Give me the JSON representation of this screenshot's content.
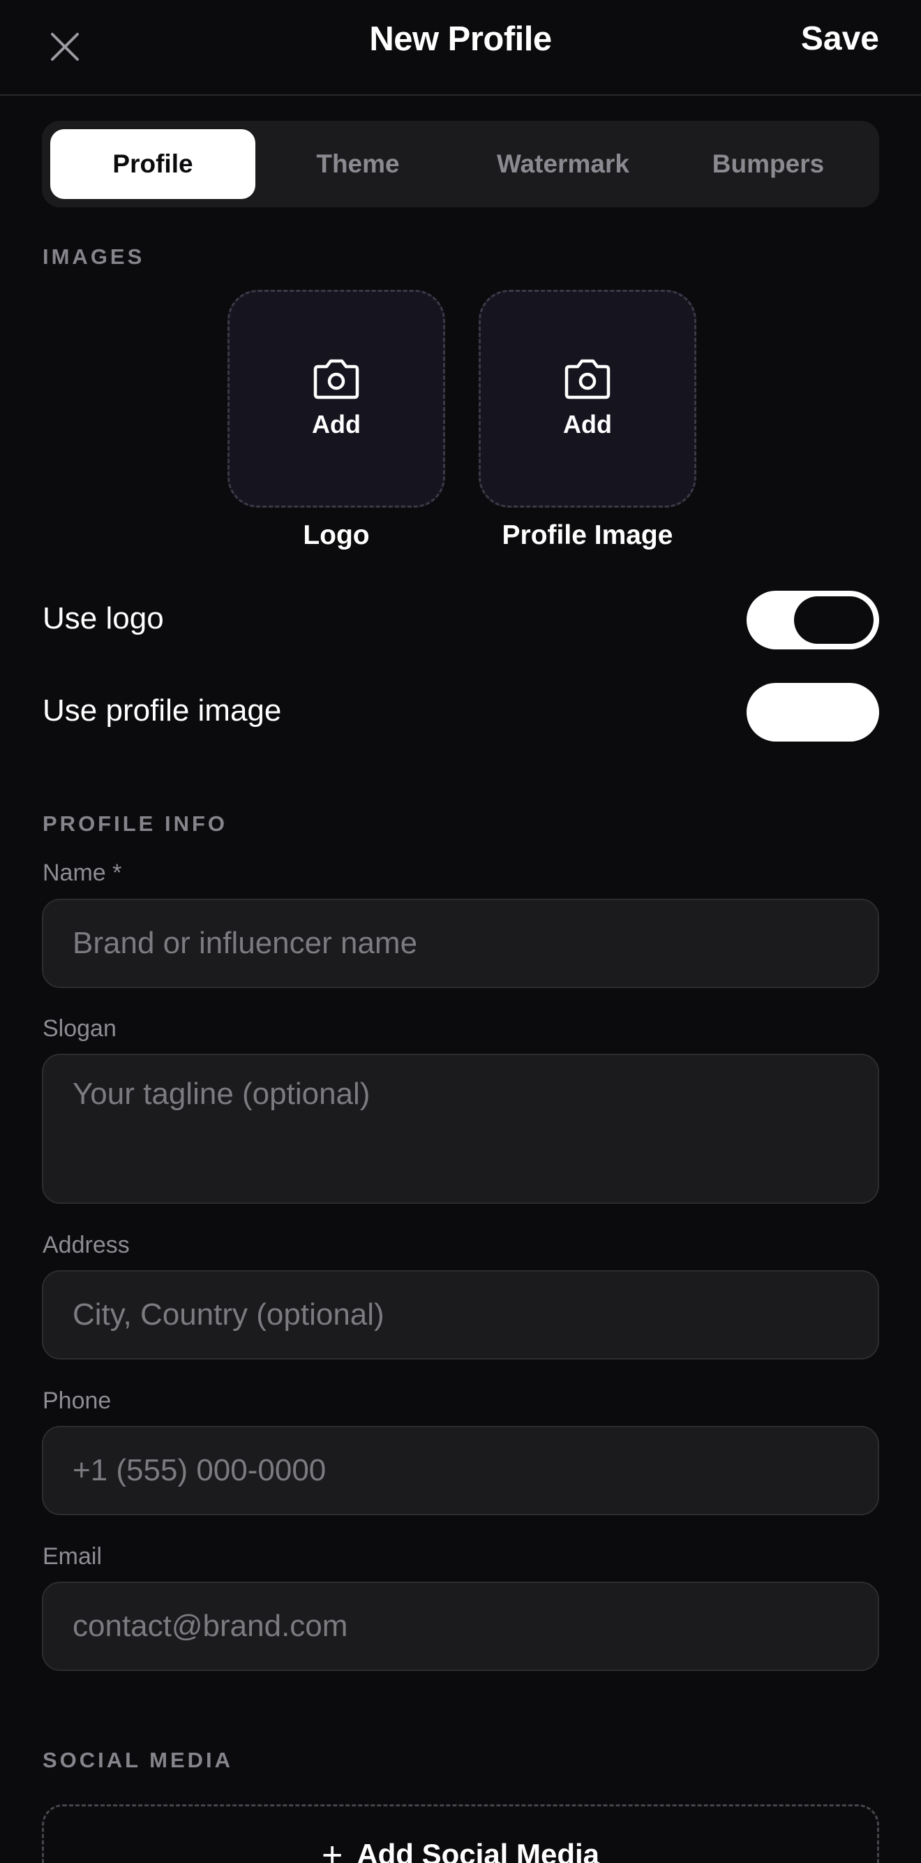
{
  "header": {
    "title": "New Profile",
    "save_label": "Save",
    "close_icon": "close-icon"
  },
  "tabs": [
    {
      "label": "Profile",
      "active": true
    },
    {
      "label": "Theme",
      "active": false
    },
    {
      "label": "Watermark",
      "active": false
    },
    {
      "label": "Bumpers",
      "active": false
    }
  ],
  "images": {
    "section_label": "IMAGES",
    "logo": {
      "action": "Add",
      "caption": "Logo",
      "icon": "camera-icon"
    },
    "profile_image": {
      "action": "Add",
      "caption": "Profile Image",
      "icon": "camera-icon"
    }
  },
  "toggles": {
    "use_logo": {
      "label": "Use logo",
      "on": true
    },
    "use_profile_image": {
      "label": "Use profile image",
      "on": false
    }
  },
  "profile_info": {
    "section_label": "PROFILE INFO",
    "name": {
      "label": "Name *",
      "placeholder": "Brand or influencer name",
      "value": ""
    },
    "slogan": {
      "label": "Slogan",
      "placeholder": "Your tagline (optional)",
      "value": ""
    },
    "address": {
      "label": "Address",
      "placeholder": "City, Country (optional)",
      "value": ""
    },
    "phone": {
      "label": "Phone",
      "placeholder": "+1 (555) 000-0000",
      "value": ""
    },
    "email": {
      "label": "Email",
      "placeholder": "contact@brand.com",
      "value": ""
    }
  },
  "social_media": {
    "section_label": "SOCIAL MEDIA",
    "add_label": "Add Social Media",
    "icon": "plus-icon"
  },
  "colors": {
    "background": "#0b0b0d",
    "surface": "#1b1b1e",
    "accent": "#ffffff",
    "muted": "#85858c"
  }
}
